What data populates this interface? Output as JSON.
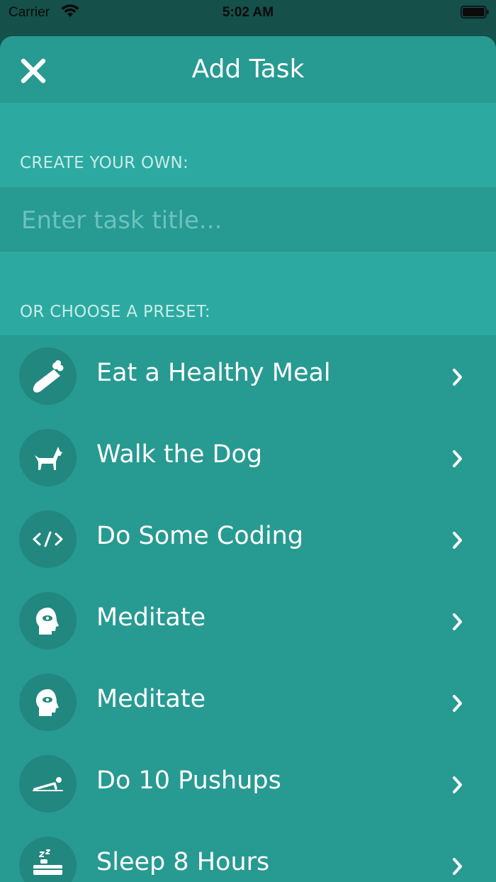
{
  "status_bar": {
    "carrier": "Carrier",
    "time": "5:02 AM"
  },
  "header": {
    "title": "Add Task",
    "close_icon": "close-icon"
  },
  "create_section": {
    "label": "CREATE YOUR OWN:",
    "input_placeholder": "Enter task title...",
    "input_value": ""
  },
  "preset_section": {
    "label": "OR CHOOSE A PRESET:",
    "items": [
      {
        "label": "Eat a Healthy Meal",
        "icon": "carrot-icon"
      },
      {
        "label": "Walk the Dog",
        "icon": "dog-icon"
      },
      {
        "label": "Do Some Coding",
        "icon": "code-icon"
      },
      {
        "label": "Meditate",
        "icon": "meditate-head-icon"
      },
      {
        "label": "Meditate",
        "icon": "meditate-head-icon"
      },
      {
        "label": "Do 10 Pushups",
        "icon": "pushup-icon"
      },
      {
        "label": "Sleep 8 Hours",
        "icon": "bed-icon"
      }
    ]
  },
  "colors": {
    "background": "#279a92",
    "section_header": "#2caaa1",
    "icon_circle": "#22877f",
    "text": "#ffffff"
  }
}
